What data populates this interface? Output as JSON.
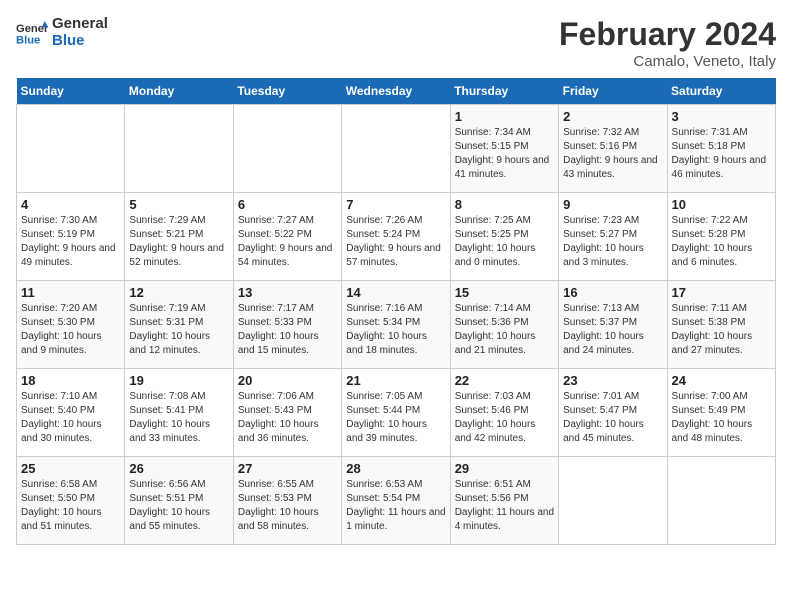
{
  "header": {
    "logo_general": "General",
    "logo_blue": "Blue",
    "month_title": "February 2024",
    "location": "Camalo, Veneto, Italy"
  },
  "days_of_week": [
    "Sunday",
    "Monday",
    "Tuesday",
    "Wednesday",
    "Thursday",
    "Friday",
    "Saturday"
  ],
  "weeks": [
    [
      {
        "day": "",
        "info": ""
      },
      {
        "day": "",
        "info": ""
      },
      {
        "day": "",
        "info": ""
      },
      {
        "day": "",
        "info": ""
      },
      {
        "day": "1",
        "info": "Sunrise: 7:34 AM\nSunset: 5:15 PM\nDaylight: 9 hours\nand 41 minutes."
      },
      {
        "day": "2",
        "info": "Sunrise: 7:32 AM\nSunset: 5:16 PM\nDaylight: 9 hours\nand 43 minutes."
      },
      {
        "day": "3",
        "info": "Sunrise: 7:31 AM\nSunset: 5:18 PM\nDaylight: 9 hours\nand 46 minutes."
      }
    ],
    [
      {
        "day": "4",
        "info": "Sunrise: 7:30 AM\nSunset: 5:19 PM\nDaylight: 9 hours\nand 49 minutes."
      },
      {
        "day": "5",
        "info": "Sunrise: 7:29 AM\nSunset: 5:21 PM\nDaylight: 9 hours\nand 52 minutes."
      },
      {
        "day": "6",
        "info": "Sunrise: 7:27 AM\nSunset: 5:22 PM\nDaylight: 9 hours\nand 54 minutes."
      },
      {
        "day": "7",
        "info": "Sunrise: 7:26 AM\nSunset: 5:24 PM\nDaylight: 9 hours\nand 57 minutes."
      },
      {
        "day": "8",
        "info": "Sunrise: 7:25 AM\nSunset: 5:25 PM\nDaylight: 10 hours\nand 0 minutes."
      },
      {
        "day": "9",
        "info": "Sunrise: 7:23 AM\nSunset: 5:27 PM\nDaylight: 10 hours\nand 3 minutes."
      },
      {
        "day": "10",
        "info": "Sunrise: 7:22 AM\nSunset: 5:28 PM\nDaylight: 10 hours\nand 6 minutes."
      }
    ],
    [
      {
        "day": "11",
        "info": "Sunrise: 7:20 AM\nSunset: 5:30 PM\nDaylight: 10 hours\nand 9 minutes."
      },
      {
        "day": "12",
        "info": "Sunrise: 7:19 AM\nSunset: 5:31 PM\nDaylight: 10 hours\nand 12 minutes."
      },
      {
        "day": "13",
        "info": "Sunrise: 7:17 AM\nSunset: 5:33 PM\nDaylight: 10 hours\nand 15 minutes."
      },
      {
        "day": "14",
        "info": "Sunrise: 7:16 AM\nSunset: 5:34 PM\nDaylight: 10 hours\nand 18 minutes."
      },
      {
        "day": "15",
        "info": "Sunrise: 7:14 AM\nSunset: 5:36 PM\nDaylight: 10 hours\nand 21 minutes."
      },
      {
        "day": "16",
        "info": "Sunrise: 7:13 AM\nSunset: 5:37 PM\nDaylight: 10 hours\nand 24 minutes."
      },
      {
        "day": "17",
        "info": "Sunrise: 7:11 AM\nSunset: 5:38 PM\nDaylight: 10 hours\nand 27 minutes."
      }
    ],
    [
      {
        "day": "18",
        "info": "Sunrise: 7:10 AM\nSunset: 5:40 PM\nDaylight: 10 hours\nand 30 minutes."
      },
      {
        "day": "19",
        "info": "Sunrise: 7:08 AM\nSunset: 5:41 PM\nDaylight: 10 hours\nand 33 minutes."
      },
      {
        "day": "20",
        "info": "Sunrise: 7:06 AM\nSunset: 5:43 PM\nDaylight: 10 hours\nand 36 minutes."
      },
      {
        "day": "21",
        "info": "Sunrise: 7:05 AM\nSunset: 5:44 PM\nDaylight: 10 hours\nand 39 minutes."
      },
      {
        "day": "22",
        "info": "Sunrise: 7:03 AM\nSunset: 5:46 PM\nDaylight: 10 hours\nand 42 minutes."
      },
      {
        "day": "23",
        "info": "Sunrise: 7:01 AM\nSunset: 5:47 PM\nDaylight: 10 hours\nand 45 minutes."
      },
      {
        "day": "24",
        "info": "Sunrise: 7:00 AM\nSunset: 5:49 PM\nDaylight: 10 hours\nand 48 minutes."
      }
    ],
    [
      {
        "day": "25",
        "info": "Sunrise: 6:58 AM\nSunset: 5:50 PM\nDaylight: 10 hours\nand 51 minutes."
      },
      {
        "day": "26",
        "info": "Sunrise: 6:56 AM\nSunset: 5:51 PM\nDaylight: 10 hours\nand 55 minutes."
      },
      {
        "day": "27",
        "info": "Sunrise: 6:55 AM\nSunset: 5:53 PM\nDaylight: 10 hours\nand 58 minutes."
      },
      {
        "day": "28",
        "info": "Sunrise: 6:53 AM\nSunset: 5:54 PM\nDaylight: 11 hours\nand 1 minute."
      },
      {
        "day": "29",
        "info": "Sunrise: 6:51 AM\nSunset: 5:56 PM\nDaylight: 11 hours\nand 4 minutes."
      },
      {
        "day": "",
        "info": ""
      },
      {
        "day": "",
        "info": ""
      }
    ]
  ]
}
